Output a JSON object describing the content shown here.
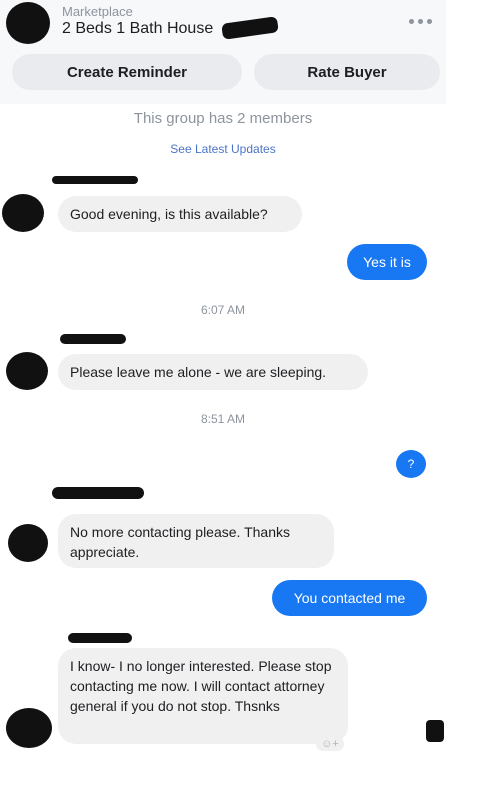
{
  "header": {
    "context_label": "Marketplace",
    "listing_title": "2 Beds 1 Bath House",
    "create_reminder_label": "Create Reminder",
    "rate_buyer_label": "Rate Buyer"
  },
  "group": {
    "members_text": "This group has 2 members",
    "see_updates_label": "See Latest Updates"
  },
  "messages": [
    {
      "side": "in",
      "text": "Good evening, is this available?"
    },
    {
      "side": "out",
      "text": "Yes it is"
    },
    {
      "side": "time",
      "text": "6:07 AM"
    },
    {
      "side": "in",
      "text": "Please leave me alone - we are sleeping."
    },
    {
      "side": "time",
      "text": "8:51 AM"
    },
    {
      "side": "out",
      "text": "?"
    },
    {
      "side": "in",
      "text": "No more contacting please. Thanks appreciate."
    },
    {
      "side": "out",
      "text": "You contacted me"
    },
    {
      "side": "in",
      "text": "I know- I  no longer interested. Please stop contacting me now. I will contact attorney general if you do not stop. Thsnks"
    }
  ],
  "colors": {
    "outgoing_bubble": "#1877f2",
    "incoming_bubble": "#f1f0f0",
    "link": "#4b74c9"
  },
  "icons": [
    "more-options-icon",
    "reaction-icon"
  ]
}
